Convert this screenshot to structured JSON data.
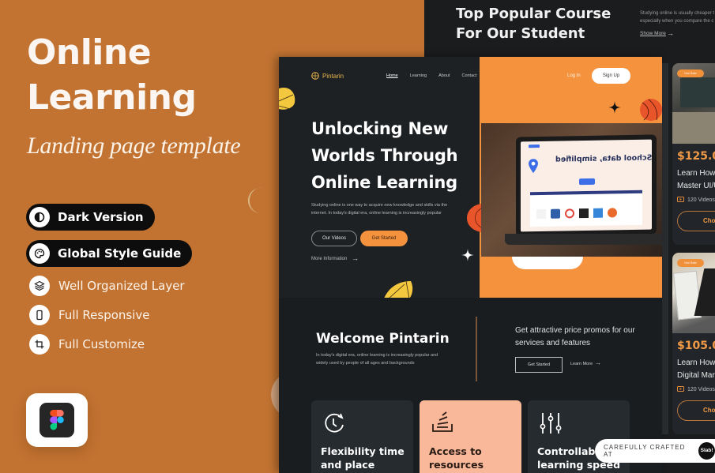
{
  "promo": {
    "title_line1": "Online",
    "title_line2": "Learning",
    "subtitle": "Landing page template",
    "features": [
      {
        "label": "Dark Version",
        "icon": "contrast-icon",
        "style": "pill"
      },
      {
        "label": "Global Style Guide",
        "icon": "palette-icon",
        "style": "pill"
      },
      {
        "label": "Well Organized Layer",
        "icon": "layers-icon",
        "style": "plain"
      },
      {
        "label": "Full Responsive",
        "icon": "mobile-icon",
        "style": "plain"
      },
      {
        "label": "Full Customize",
        "icon": "crop-icon",
        "style": "plain"
      }
    ],
    "tool_badge": "figma-icon"
  },
  "popular": {
    "title_line1": "Top Popular Course",
    "title_line2": "For Our Student",
    "desc_line1": "Studying online is usually cheaper t",
    "desc_line2": "especially when you compare the c",
    "show_more": "Show More",
    "arrow": "→",
    "courses": [
      {
        "badge": "Hot Sale",
        "price": "$125.0",
        "title_line1": "Learn How",
        "title_line2": "Master UI/U",
        "videos": "120 Videos",
        "button": "Cho"
      },
      {
        "badge": "Hot Sale",
        "price": "$105.0",
        "title_line1": "Learn How",
        "title_line2": "Digital Mark",
        "videos": "120 Videos",
        "button": "Cho"
      }
    ]
  },
  "site": {
    "brand": "Pintarin",
    "nav": [
      {
        "label": "Home",
        "active": true
      },
      {
        "label": "Learning",
        "active": false
      },
      {
        "label": "About",
        "active": false
      },
      {
        "label": "Contact",
        "active": false
      }
    ],
    "login": "Log In",
    "signup": "Sign Up",
    "hero": {
      "title_line1": "Unlocking New",
      "title_line2": "Worlds Through",
      "title_line3": "Online Learning",
      "desc": "Studying online is one way to acquire new knowledge and skills via the internet. In today's digital era, online learning is increasingly popular",
      "btn_secondary": "Our Videos",
      "btn_primary": "Get Started",
      "more_info": "More Information",
      "arrow": "→",
      "screen_headline": "School data, simplified"
    },
    "welcome": {
      "title": "Welcome Pintarin",
      "desc": "In today's digital era, online learning is increasingly popular and widely used by people of all ages and backgrounds",
      "promo_text": "Get attractive price promos for our services and features",
      "btn": "Get Started",
      "learn_more": "Learn More",
      "arrow": "→"
    },
    "features": [
      {
        "title_line1": "Flexibility time",
        "title_line2": "and place",
        "icon": "clock-refresh-icon"
      },
      {
        "title_line1": "Access to",
        "title_line2": "resources",
        "icon": "resources-stack-icon"
      },
      {
        "title_line1": "Controllable",
        "title_line2": "learning speed",
        "icon": "sliders-icon"
      }
    ]
  },
  "credit": {
    "text": "CAREFULLY CRAFTED AT",
    "brand": "Slab!"
  },
  "colors": {
    "background": "#c27331",
    "accent_orange": "#f4923d",
    "dark_surface": "#1d2124",
    "peach_card": "#f9b89a",
    "price_orange": "#f29a45",
    "brand_yellow": "#e9b44c"
  }
}
